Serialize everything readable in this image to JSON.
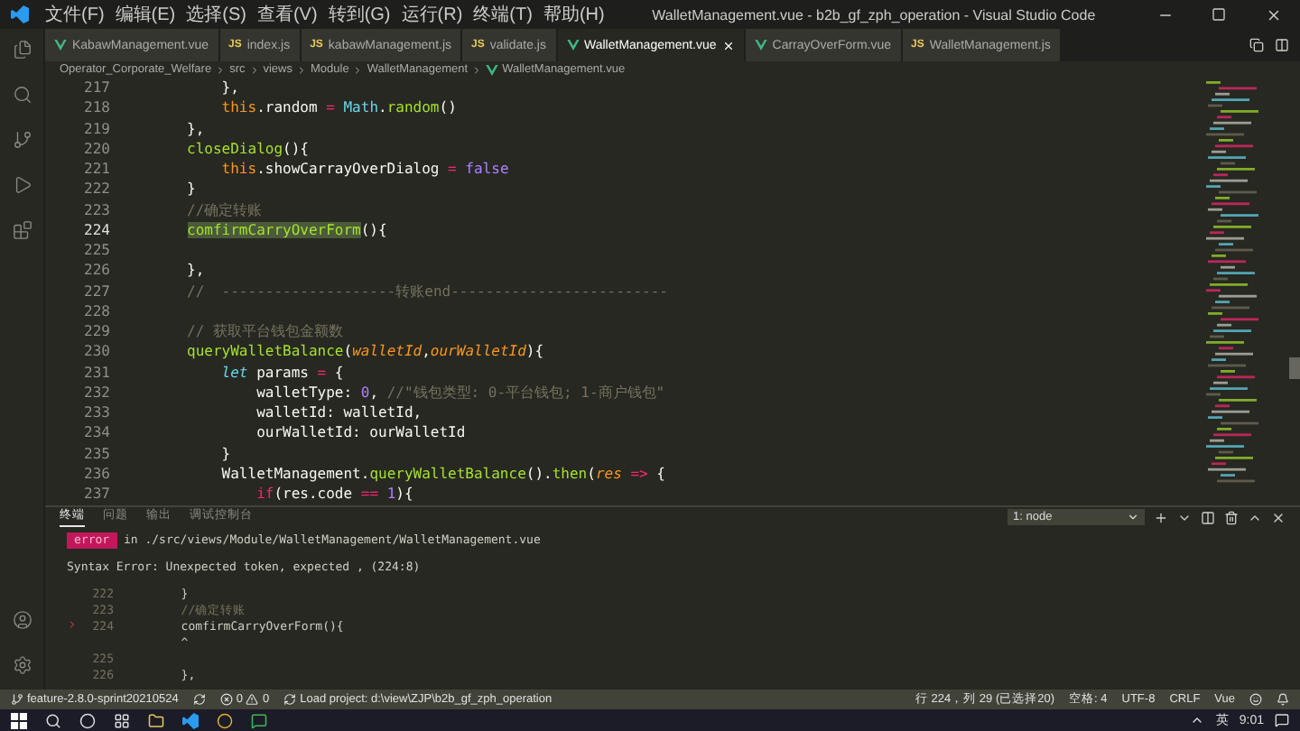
{
  "window": {
    "title": "WalletManagement.vue - b2b_gf_zph_operation - Visual Studio Code"
  },
  "menu": [
    "文件(F)",
    "编辑(E)",
    "选择(S)",
    "查看(V)",
    "转到(G)",
    "运行(R)",
    "终端(T)",
    "帮助(H)"
  ],
  "tabs": [
    {
      "label": "KabawManagement.vue",
      "kind": "vue",
      "selected": false
    },
    {
      "label": "index.js",
      "kind": "js",
      "icon_text": "JS",
      "selected": false
    },
    {
      "label": "kabawManagement.js",
      "kind": "js",
      "icon_text": "JS",
      "selected": false
    },
    {
      "label": "validate.js",
      "kind": "js",
      "icon_text": "JS",
      "selected": false
    },
    {
      "label": "WalletManagement.vue",
      "kind": "vue",
      "selected": true
    },
    {
      "label": "CarrayOverForm.vue",
      "kind": "vue",
      "selected": false
    },
    {
      "label": "WalletManagement.js",
      "kind": "js",
      "icon_text": "JS",
      "selected": false
    }
  ],
  "breadcrumb": [
    "Operator_Corporate_Welfare",
    "src",
    "views",
    "Module",
    "WalletManagement",
    "WalletManagement.vue"
  ],
  "editor": {
    "lines": [
      {
        "number": "217",
        "current": false,
        "tokens": [
          {
            "kind": "plain",
            "text": "            },"
          }
        ]
      },
      {
        "number": "218",
        "current": false,
        "tokens": [
          {
            "kind": "this",
            "text": "            this"
          },
          {
            "kind": "plain",
            "text": ".random "
          },
          {
            "kind": "op",
            "text": "="
          },
          {
            "kind": "class",
            "text": " Math"
          },
          {
            "kind": "plain",
            "text": "."
          },
          {
            "kind": "fn",
            "text": "random"
          },
          {
            "kind": "plain",
            "text": "()"
          }
        ]
      },
      {
        "number": "219",
        "current": false,
        "tokens": [
          {
            "kind": "plain",
            "text": "        },"
          }
        ]
      },
      {
        "number": "220",
        "current": false,
        "tokens": [
          {
            "kind": "fn",
            "text": "        closeDialog"
          },
          {
            "kind": "plain",
            "text": "(){"
          }
        ]
      },
      {
        "number": "221",
        "current": false,
        "tokens": [
          {
            "kind": "this",
            "text": "            this"
          },
          {
            "kind": "plain",
            "text": ".showCarrayOverDialog "
          },
          {
            "kind": "op",
            "text": "="
          },
          {
            "kind": "const",
            "text": " false"
          }
        ]
      },
      {
        "number": "222",
        "current": false,
        "tokens": [
          {
            "kind": "plain",
            "text": "        }"
          }
        ]
      },
      {
        "number": "223",
        "current": false,
        "tokens": [
          {
            "kind": "comment",
            "text": "        //确定转账"
          }
        ]
      },
      {
        "number": "224",
        "current": true,
        "tokens": [
          {
            "kind": "selection",
            "text": "        comfirmCarryOverForm"
          },
          {
            "kind": "plain",
            "text": "(){"
          }
        ]
      },
      {
        "number": "225",
        "current": false
      },
      {
        "number": "226",
        "current": false,
        "tokens": [
          {
            "kind": "plain",
            "text": "        },"
          }
        ]
      },
      {
        "number": "227",
        "current": false,
        "tokens": [
          {
            "kind": "comment",
            "text": "        //  --------------------转账end-------------------------"
          }
        ]
      },
      {
        "number": "228",
        "current": false
      },
      {
        "number": "229",
        "current": false,
        "tokens": [
          {
            "kind": "comment",
            "text": "        // 获取平台钱包金额数"
          }
        ]
      },
      {
        "number": "230",
        "current": false,
        "tokens": [
          {
            "kind": "fn",
            "text": "        queryWalletBalance"
          },
          {
            "kind": "plain",
            "text": "("
          },
          {
            "kind": "param",
            "text": "walletId"
          },
          {
            "kind": "plain",
            "text": ","
          },
          {
            "kind": "param",
            "text": "ourWalletId"
          },
          {
            "kind": "plain",
            "text": "){"
          }
        ]
      },
      {
        "number": "231",
        "current": false,
        "tokens": [
          {
            "kind": "keyword",
            "text": "            let"
          },
          {
            "kind": "plain",
            "text": " params "
          },
          {
            "kind": "op",
            "text": "="
          },
          {
            "kind": "plain",
            "text": " {"
          }
        ]
      },
      {
        "number": "232",
        "current": false,
        "tokens": [
          {
            "kind": "plain",
            "text": "                walletType: "
          },
          {
            "kind": "const",
            "text": "0"
          },
          {
            "kind": "plain",
            "text": ", "
          },
          {
            "kind": "comment",
            "text": "//\"钱包类型: 0-平台钱包; 1-商户钱包\""
          }
        ]
      },
      {
        "number": "233",
        "current": false,
        "tokens": [
          {
            "kind": "plain",
            "text": "                walletId: walletId,"
          }
        ]
      },
      {
        "number": "234",
        "current": false,
        "tokens": [
          {
            "kind": "plain",
            "text": "                ourWalletId: ourWalletId"
          }
        ]
      },
      {
        "number": "235",
        "current": false,
        "tokens": [
          {
            "kind": "plain",
            "text": "            }"
          }
        ]
      },
      {
        "number": "236",
        "current": false,
        "tokens": [
          {
            "kind": "plain",
            "text": "            WalletManagement."
          },
          {
            "kind": "fn",
            "text": "queryWalletBalance"
          },
          {
            "kind": "plain",
            "text": "()."
          },
          {
            "kind": "fn",
            "text": "then"
          },
          {
            "kind": "plain",
            "text": "("
          },
          {
            "kind": "param",
            "text": "res"
          },
          {
            "kind": "op",
            "text": " =>"
          },
          {
            "kind": "plain",
            "text": " {"
          }
        ]
      },
      {
        "number": "237",
        "current": false,
        "tokens": [
          {
            "kind": "if",
            "text": "                if"
          },
          {
            "kind": "plain",
            "text": "(res.code "
          },
          {
            "kind": "op",
            "text": "=="
          },
          {
            "kind": "const",
            "text": " 1"
          },
          {
            "kind": "plain",
            "text": "){"
          }
        ]
      }
    ]
  },
  "panel": {
    "tabs": [
      {
        "label": "终端",
        "selected": true
      },
      {
        "label": "问题",
        "selected": false
      },
      {
        "label": "输出",
        "selected": false
      },
      {
        "label": "调试控制台",
        "selected": false
      }
    ],
    "terminal_select": "1: node",
    "error_badge": "error",
    "error_path": " in ./src/views/Module/WalletManagement/WalletManagement.vue",
    "error_message": "Syntax Error: Unexpected token, expected , (224:8)",
    "frame": [
      {
        "marker": false,
        "number": "222",
        "code": "        }"
      },
      {
        "marker": false,
        "number": "223",
        "code": "        //确定转账"
      },
      {
        "marker": true,
        "number": "224",
        "code": "        comfirmCarryOverForm(){"
      },
      {
        "marker": false,
        "code": "        ^"
      },
      {
        "marker": false,
        "number": "225"
      },
      {
        "marker": false,
        "number": "226",
        "code": "        },"
      }
    ]
  },
  "status_bar": {
    "branch": "feature-2.8.0-sprint20210524",
    "errors": "0",
    "warnings": "0",
    "task": "Load project: d:\\view\\ZJP\\b2b_gf_zph_operation",
    "right": [
      "行 224，列 29 (已选择20)",
      "空格: 4",
      "UTF-8",
      "CRLF",
      "Vue"
    ]
  },
  "taskbar": {
    "language": "英",
    "time": "9:01"
  }
}
